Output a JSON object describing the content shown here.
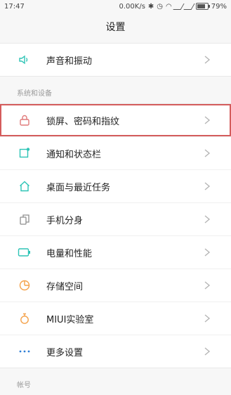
{
  "status_bar": {
    "time": "17:47",
    "speed": "0.00K/s",
    "battery": "79%"
  },
  "header": {
    "title": "设置"
  },
  "group1": {
    "items": [
      {
        "label": "声音和振动",
        "icon": "speaker-icon"
      }
    ]
  },
  "section_system": {
    "title": "系统和设备"
  },
  "group2": {
    "items": [
      {
        "label": "锁屏、密码和指纹",
        "icon": "lock-icon"
      },
      {
        "label": "通知和状态栏",
        "icon": "notification-icon"
      },
      {
        "label": "桌面与最近任务",
        "icon": "home-icon"
      },
      {
        "label": "手机分身",
        "icon": "clone-icon"
      },
      {
        "label": "电量和性能",
        "icon": "battery-icon"
      },
      {
        "label": "存储空间",
        "icon": "storage-icon"
      },
      {
        "label": "MIUI实验室",
        "icon": "lab-icon"
      },
      {
        "label": "更多设置",
        "icon": "more-icon"
      }
    ]
  },
  "section_account": {
    "title": "帐号"
  },
  "colors": {
    "accent": "#2ec4b6",
    "lock_red": "#e07a7a",
    "storage_orange": "#f4a24b",
    "highlight_border": "#d45c5c"
  }
}
